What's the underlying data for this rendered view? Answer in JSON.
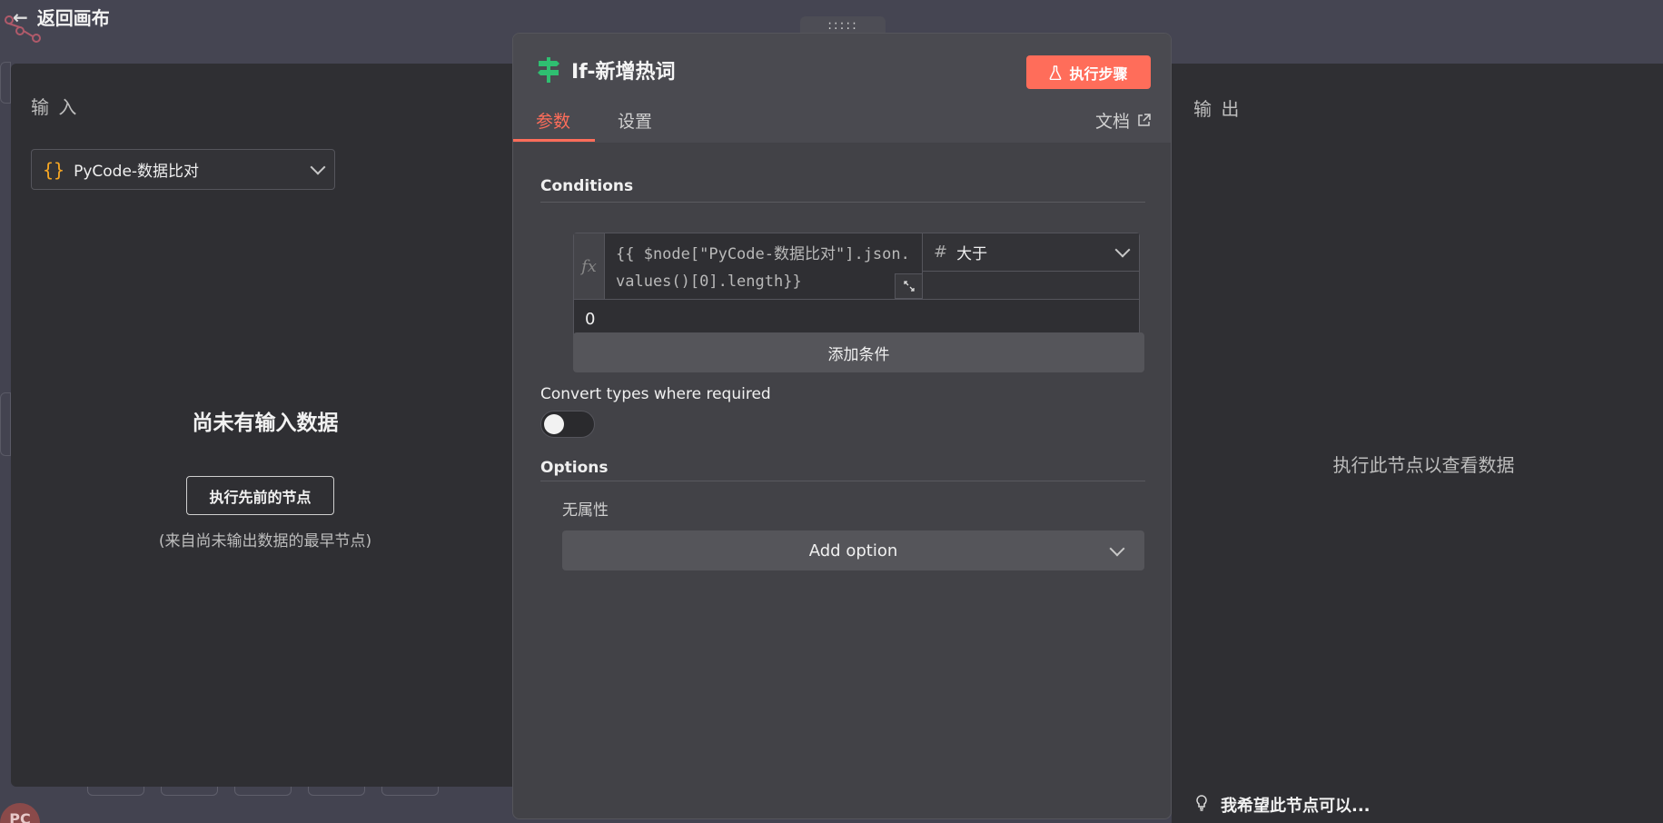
{
  "canvas": {
    "back_label": "返回画布",
    "avatar_initials": "PC"
  },
  "input_panel": {
    "title": "输 入",
    "source_node": "PyCode-数据比对",
    "empty_title": "尚未有输入数据",
    "run_previous_label": "执行先前的节点",
    "empty_hint": "(来自尚未输出数据的最早节点)"
  },
  "output_panel": {
    "title": "输 出",
    "empty_text": "执行此节点以查看数据",
    "feedback_text": "我希望此节点可以..."
  },
  "modal": {
    "drag_handle": ":::::",
    "node_name": "If-新增热词",
    "execute_label": "执行步骤",
    "tabs": [
      {
        "label": "参数",
        "active": true
      },
      {
        "label": "设置",
        "active": false
      }
    ],
    "docs_label": "文档",
    "conditions_label": "Conditions",
    "condition": {
      "fx_label": "fx",
      "expression": "{{ $node[\"PyCode-数据比对\"].json.values()[0].length}}",
      "operator": "大于",
      "value": "0"
    },
    "add_condition_label": "添加条件",
    "convert_types_label": "Convert types where required",
    "convert_types_enabled": false,
    "options_label": "Options",
    "no_properties": "无属性",
    "add_option_label": "Add option"
  },
  "colors": {
    "accent": "#ff6d5a",
    "node_icon": "#2fbf71",
    "braces": "#f5a623"
  }
}
